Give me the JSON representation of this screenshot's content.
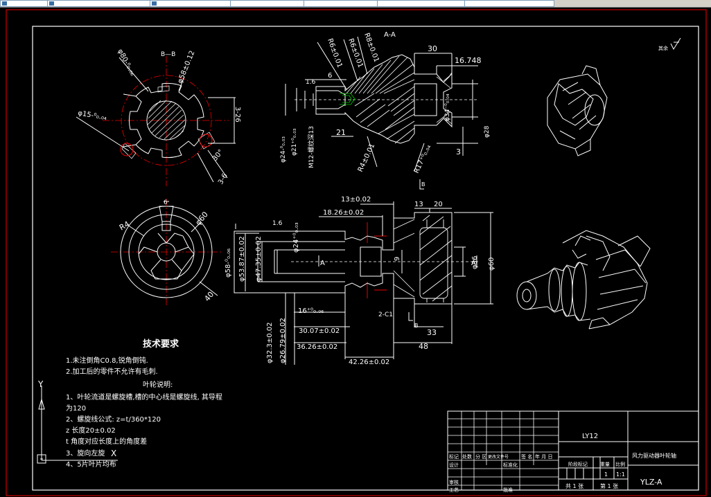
{
  "toolbar": {
    "fields": [
      "",
      "",
      "",
      "",
      "",
      "",
      ""
    ]
  },
  "section_bb": {
    "title": "B—B",
    "dia_outer": "φ80-⁰₀.₀₆",
    "dia_mid": "φ58±0.12",
    "dia_small": "φ15-⁰₀.₀₄",
    "dim_326": "3-26",
    "dim_30": "30°",
    "dim_36": "3-6"
  },
  "section_aa": {
    "title": "A-A",
    "r_a": "R6±0.01",
    "r_b": "R6±0.01",
    "r_c": "R8±0.01",
    "dim_30": "30",
    "dim_16748": "16.748",
    "dim_16": "1.6",
    "dim_6": "6",
    "dim_21": "21",
    "dim_3": "3",
    "dia_34": "φ34⁻⁰₀.₀₄",
    "dia_28": "φ28",
    "dia_24": "φ24-⁰₀.₀₃",
    "dia_21": "φ21⁺⁰₀.₀₃",
    "m12": "M12-螺纹深13",
    "r4": "R4±0.01",
    "r17": "R17⁺⁰₀.₀₄"
  },
  "front_view": {
    "r4": "R4",
    "dim_6": "6",
    "dia_60": "φ60",
    "dim_40": "40"
  },
  "main_view": {
    "dia_24": "φ24⁺⁰₀.₀₃",
    "dim_13": "13±0.02",
    "dim_1826": "18.26±0.02",
    "dim_13b": "13",
    "dim_20": "20",
    "dim_16": "1.6",
    "dia_58": "φ58-⁰₀.₀₆",
    "dia_5387": "φ53.87±0.02",
    "dia_4735": "φ47.35±0.02",
    "sec_a_left": "A",
    "sec_a_right": "A",
    "sec_b": "B",
    "sec_b_bottom": "B",
    "dim_9": "9",
    "dia_36": "φ36",
    "dia_60": "φ60",
    "dim_2c1": "2-C1",
    "dim_16b": "16⁺⁰₀.₀₆",
    "dia_323": "φ32.3±0.02",
    "dia_2679": "φ26.79±0.02",
    "dim_3007": "30.07±0.02",
    "dim_3626": "36.26±0.02",
    "dim_4226": "42.26±0.02",
    "dim_33": "33",
    "dim_48": "48"
  },
  "roughness_note": "其余",
  "notes": {
    "heading": "技术要求",
    "line1": "1.未注倒角C0.8,锐角倒钝.",
    "line2": "2.加工后的零件不允许有毛刺.",
    "subheading": "叶轮说明:",
    "item1a": "1、叶轮流道是螺旋槽,槽的中心线是螺旋线, 其导程",
    "item1b": "为120",
    "item2": "2、螺旋线公式: z=t/360*120",
    "item_z": "z   长度20±0.02",
    "item_t": "t    角度对应长度上的角度差",
    "item3": "3、旋向左旋",
    "item4": "4、5片叶片均布"
  },
  "ucs": {
    "y": "Y",
    "x": "X"
  },
  "title_block": {
    "material": "LY12",
    "part_name": "风力驱动器叶轮轴",
    "drawing_no": "YLZ-A",
    "scale_label": "比例",
    "weight_label": "重量",
    "stage_label": "阶段标记",
    "qty": "1",
    "scale": "1:1",
    "sheets_total": "共 1 张",
    "sheet_no": "第 1 张",
    "c_mark": "标记",
    "c_count": "处数",
    "c_zone": "分 区",
    "c_doc": "更改文件号",
    "c_sign": "签 名",
    "c_date": "年 月 日",
    "r_design": "设计",
    "r_std": "标准化",
    "r_check": "审核",
    "r_process": "工艺",
    "r_approve": "批准"
  }
}
